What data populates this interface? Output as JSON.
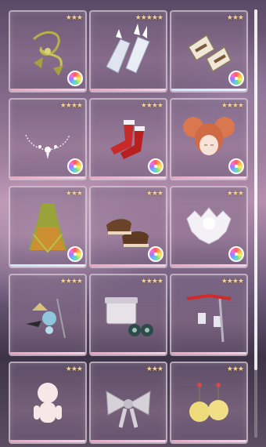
{
  "inventory": {
    "items": [
      {
        "name": "green-ribbon-accessory",
        "rarity": "★★★",
        "strip": "pink",
        "palette": true
      },
      {
        "name": "crystal-gloves",
        "rarity": "★★★★★",
        "strip": "pink",
        "palette": false
      },
      {
        "name": "cream-arm-cuffs",
        "rarity": "★★★",
        "strip": "blue",
        "palette": true
      },
      {
        "name": "silver-necklace",
        "rarity": "★★★★",
        "strip": "pink",
        "palette": true
      },
      {
        "name": "red-socks",
        "rarity": "★★★★",
        "strip": "pink",
        "palette": true
      },
      {
        "name": "red-twin-bun-hair",
        "rarity": "★★★★",
        "strip": "pink",
        "palette": true
      },
      {
        "name": "green-orange-dress",
        "rarity": "★★★",
        "strip": "blue",
        "palette": true
      },
      {
        "name": "brown-shoes",
        "rarity": "★★★",
        "strip": "pink",
        "palette": true
      },
      {
        "name": "white-fur-collar",
        "rarity": "★★★",
        "strip": "pink",
        "palette": true
      },
      {
        "name": "blue-jewel-hairpin",
        "rarity": "★★★★",
        "strip": "pink",
        "palette": false
      },
      {
        "name": "white-hatbox-and-eyes",
        "rarity": "★★★★",
        "strip": "pink",
        "palette": false
      },
      {
        "name": "red-ribbon-earrings",
        "rarity": "★★★★",
        "strip": "pink",
        "palette": false
      },
      {
        "name": "doll-figure",
        "rarity": "★★★",
        "strip": "pink",
        "palette": false
      },
      {
        "name": "gray-bow",
        "rarity": "★★★",
        "strip": "pink",
        "palette": false
      },
      {
        "name": "yellow-flower-earrings",
        "rarity": "★★★",
        "strip": "pink",
        "palette": false
      }
    ]
  },
  "colors": {
    "star": "#f4d38a",
    "strip_pink": "#f2a3b8",
    "strip_blue": "#c8e6f1"
  }
}
